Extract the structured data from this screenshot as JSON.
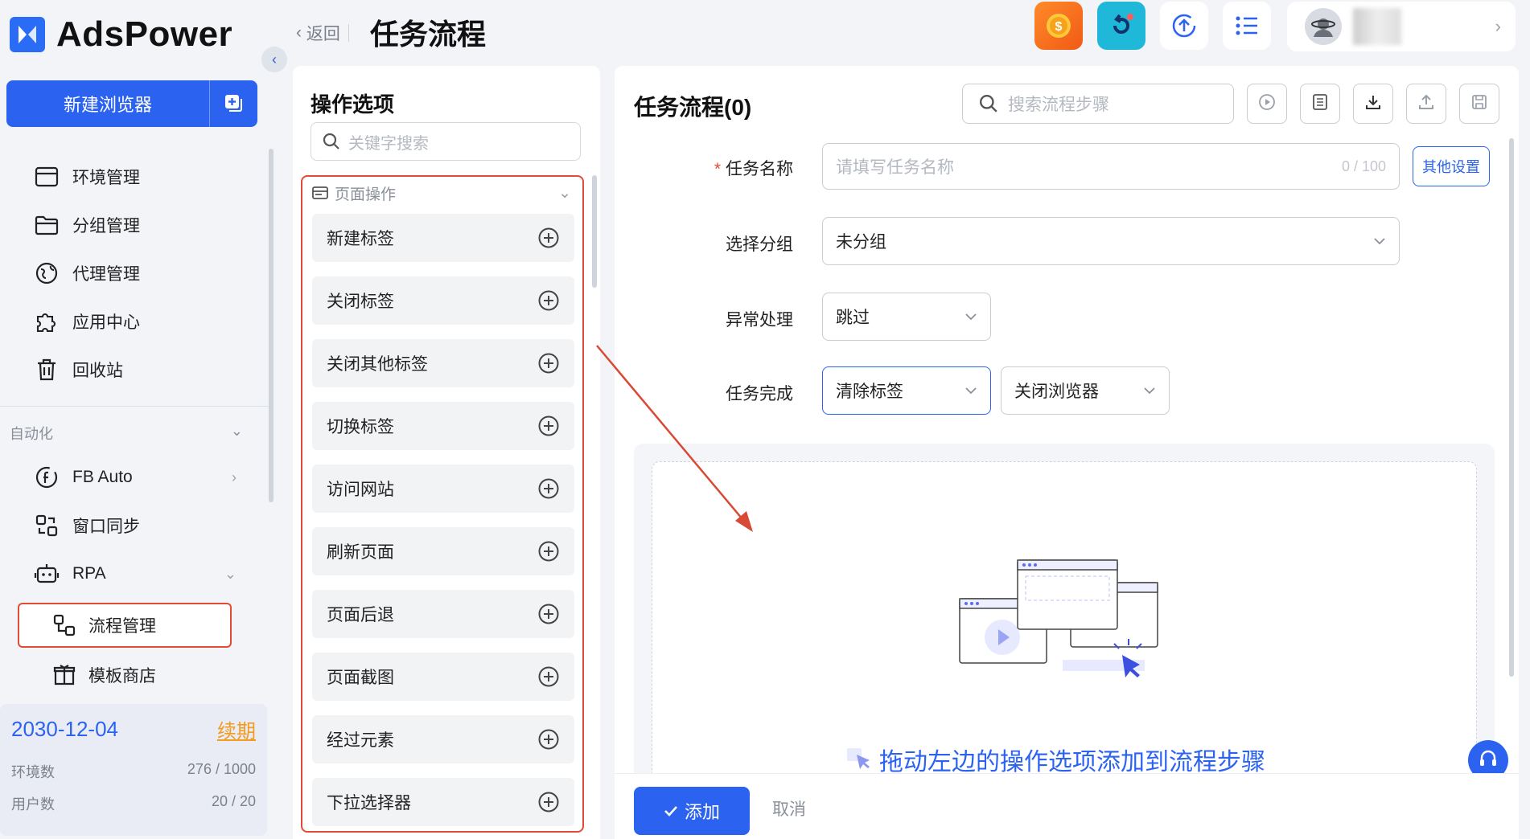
{
  "app": {
    "brand": "AdsPower",
    "brand_color": "#2b63f0"
  },
  "sidebar": {
    "new_browser_label": "新建浏览器",
    "items": [
      {
        "label": "环境管理",
        "icon": "window-icon"
      },
      {
        "label": "分组管理",
        "icon": "folder-icon"
      },
      {
        "label": "代理管理",
        "icon": "proxy-icon"
      },
      {
        "label": "应用中心",
        "icon": "puzzle-icon"
      },
      {
        "label": "回收站",
        "icon": "trash-icon"
      }
    ],
    "automation_section": "自动化",
    "automation_items": [
      {
        "label": "FB Auto",
        "icon": "facebook-icon"
      },
      {
        "label": "窗口同步",
        "icon": "sync-icon"
      },
      {
        "label": "RPA",
        "icon": "robot-icon"
      }
    ],
    "rpa_sub": [
      {
        "label": "流程管理",
        "icon": "flow-icon"
      },
      {
        "label": "模板商店",
        "icon": "store-icon"
      }
    ],
    "info": {
      "expire_date": "2030-12-04",
      "renew_label": "续期",
      "env_label": "环境数",
      "env_value": "276 / 1000",
      "user_label": "用户数",
      "user_value": "20 / 20"
    }
  },
  "header": {
    "back_label": "返回",
    "title": "任务流程"
  },
  "ops": {
    "title": "操作选项",
    "search_placeholder": "关键字搜索",
    "group_label": "页面操作",
    "items": [
      "新建标签",
      "关闭标签",
      "关闭其他标签",
      "切换标签",
      "访问网站",
      "刷新页面",
      "页面后退",
      "页面截图",
      "经过元素",
      "下拉选择器"
    ]
  },
  "flow": {
    "title": "任务流程(0)",
    "search_placeholder": "搜索流程步骤",
    "name_label": "任务名称",
    "name_placeholder": "请填写任务名称",
    "name_count": "0 / 100",
    "other_settings": "其他设置",
    "group_label": "选择分组",
    "group_value": "未分组",
    "error_label": "异常处理",
    "error_value": "跳过",
    "done_label": "任务完成",
    "done_value1": "清除标签",
    "done_value2": "关闭浏览器",
    "drop_hint": "拖动左边的操作选项添加到流程步骤",
    "add_label": "添加",
    "cancel_label": "取消"
  },
  "colors": {
    "accent": "#2b63f0",
    "highlight": "#e34b35",
    "coin": "#f26a1b",
    "refresh": "#20b8d8"
  }
}
